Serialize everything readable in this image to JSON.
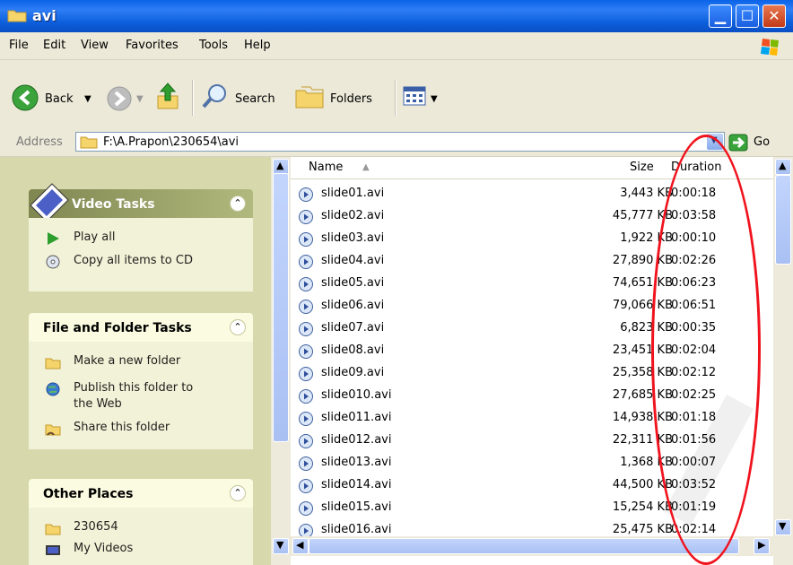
{
  "window": {
    "title": "avi"
  },
  "menu": [
    "File",
    "Edit",
    "View",
    "Favorites",
    "Tools",
    "Help"
  ],
  "toolbar": {
    "back": "Back",
    "search": "Search",
    "folders": "Folders"
  },
  "address": {
    "label": "Address",
    "value": "F:\\A.Prapon\\230654\\avi",
    "go": "Go"
  },
  "sidebar": {
    "video_tasks": {
      "title": "Video Tasks",
      "items": [
        "Play all",
        "Copy all items to CD"
      ]
    },
    "file_folder_tasks": {
      "title": "File and Folder Tasks",
      "items": [
        "Make a new folder",
        "Publish this folder to",
        "the Web",
        "Share this folder"
      ]
    },
    "other_places": {
      "title": "Other Places",
      "items": [
        "230654",
        "My Videos"
      ]
    }
  },
  "columns": {
    "name": "Name",
    "size": "Size",
    "duration": "Duration"
  },
  "files": [
    {
      "name": "slide01.avi",
      "size": "3,443 KB",
      "duration": "0:00:18"
    },
    {
      "name": "slide02.avi",
      "size": "45,777 KB",
      "duration": "0:03:58"
    },
    {
      "name": "slide03.avi",
      "size": "1,922 KB",
      "duration": "0:00:10"
    },
    {
      "name": "slide04.avi",
      "size": "27,890 KB",
      "duration": "0:02:26"
    },
    {
      "name": "slide05.avi",
      "size": "74,651 KB",
      "duration": "0:06:23"
    },
    {
      "name": "slide06.avi",
      "size": "79,066 KB",
      "duration": "0:06:51"
    },
    {
      "name": "slide07.avi",
      "size": "6,823 KB",
      "duration": "0:00:35"
    },
    {
      "name": "slide08.avi",
      "size": "23,451 KB",
      "duration": "0:02:04"
    },
    {
      "name": "slide09.avi",
      "size": "25,358 KB",
      "duration": "0:02:12"
    },
    {
      "name": "slide010.avi",
      "size": "27,685 KB",
      "duration": "0:02:25"
    },
    {
      "name": "slide011.avi",
      "size": "14,938 KB",
      "duration": "0:01:18"
    },
    {
      "name": "slide012.avi",
      "size": "22,311 KB",
      "duration": "0:01:56"
    },
    {
      "name": "slide013.avi",
      "size": "1,368 KB",
      "duration": "0:00:07"
    },
    {
      "name": "slide014.avi",
      "size": "44,500 KB",
      "duration": "0:03:52"
    },
    {
      "name": "slide015.avi",
      "size": "15,254 KB",
      "duration": "0:01:19"
    },
    {
      "name": "slide016.avi",
      "size": "25,475 KB",
      "duration": "0:02:14"
    }
  ],
  "colors": {
    "titlebar": "#0A5FDC",
    "annotation": "#F0131D",
    "panel_head": "#FBFBE1"
  }
}
